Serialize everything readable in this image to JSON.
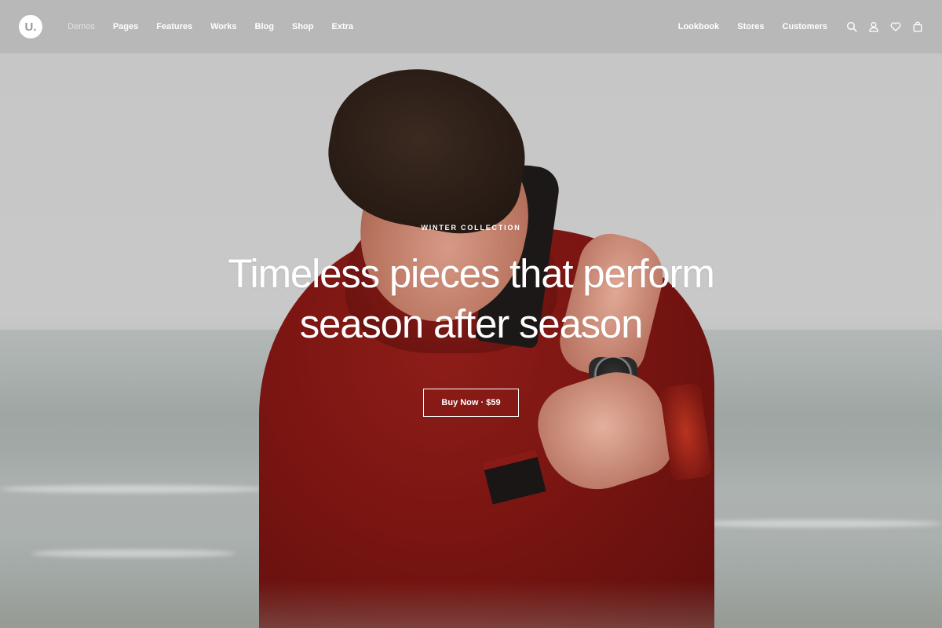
{
  "header": {
    "logo": "U.",
    "nav_left": [
      "Demos",
      "Pages",
      "Features",
      "Works",
      "Blog",
      "Shop",
      "Extra"
    ],
    "nav_right": [
      "Lookbook",
      "Stores",
      "Customers"
    ],
    "icons": [
      "search-icon",
      "user-icon",
      "heart-icon",
      "bag-icon"
    ]
  },
  "hero": {
    "eyebrow": "WINTER COLLECTION",
    "headline_line1": "Timeless pieces that perform",
    "headline_line2": "season after season",
    "cta_label": "Buy Now · $59"
  },
  "colors": {
    "header_bg": "#b4b4b4",
    "text": "#ffffff",
    "jacket": "#7a1512"
  }
}
